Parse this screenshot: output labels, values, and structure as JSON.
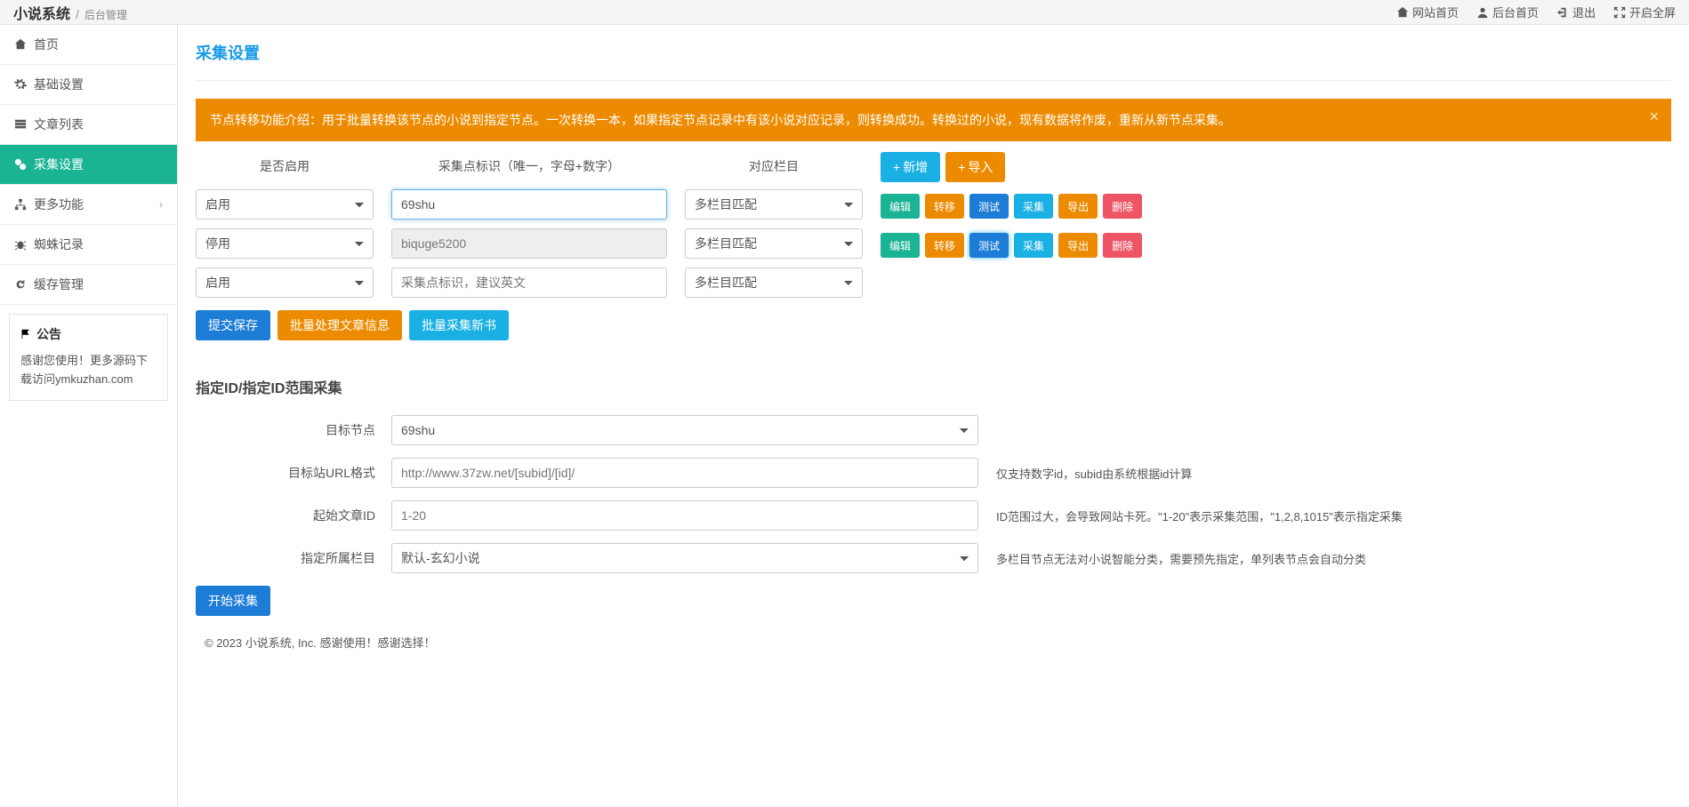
{
  "topbar": {
    "brand": "小说系统",
    "brand_sub": "后台管理",
    "links": {
      "site_home": "网站首页",
      "admin_home": "后台首页",
      "logout": "退出",
      "fullscreen": "开启全屏"
    }
  },
  "sidebar": {
    "items": [
      {
        "label": "首页"
      },
      {
        "label": "基础设置"
      },
      {
        "label": "文章列表"
      },
      {
        "label": "采集设置"
      },
      {
        "label": "更多功能"
      },
      {
        "label": "蜘蛛记录"
      },
      {
        "label": "缓存管理"
      }
    ],
    "notice_title": "公告",
    "notice_text": "感谢您使用！更多源码下载访问ymkuzhan.com"
  },
  "page": {
    "title": "采集设置",
    "alert": "节点转移功能介绍：用于批量转换该节点的小说到指定节点。一次转换一本，如果指定节点记录中有该小说对应记录，则转换成功。转换过的小说，现有数据将作废，重新从新节点采集。"
  },
  "grid": {
    "headers": {
      "enable": "是否启用",
      "ident": "采集点标识（唯一，字母+数字）",
      "category": "对应栏目"
    },
    "top_buttons": {
      "add": "新增",
      "import": "导入"
    },
    "row_actions": {
      "edit": "编辑",
      "transfer": "转移",
      "test": "测试",
      "collect": "采集",
      "export": "导出",
      "delete": "删除"
    },
    "rows": [
      {
        "enable": "启用",
        "ident": "69shu",
        "category": "多栏目匹配"
      },
      {
        "enable": "停用",
        "ident": "biquge5200",
        "category": "多栏目匹配"
      },
      {
        "enable": "启用",
        "ident_placeholder": "采集点标识，建议英文",
        "category": "多栏目匹配"
      }
    ],
    "submit": {
      "save": "提交保存",
      "batch_info": "批量处理文章信息",
      "batch_collect": "批量采集新书"
    }
  },
  "id_section": {
    "title": "指定ID/指定ID范围采集",
    "target_label": "目标节点",
    "target_value": "69shu",
    "url_label": "目标站URL格式",
    "url_placeholder": "http://www.37zw.net/[subid]/[id]/",
    "url_help": "仅支持数字id，subid由系统根据id计算",
    "start_label": "起始文章ID",
    "start_placeholder": "1-20",
    "start_help": "ID范围过大，会导致网站卡死。\"1-20\"表示采集范围，\"1,2,8,1015\"表示指定采集",
    "cat_label": "指定所属栏目",
    "cat_value": "默认-玄幻小说",
    "cat_help": "多栏目节点无法对小说智能分类，需要预先指定，单列表节点会自动分类",
    "submit": "开始采集"
  },
  "footer": "© 2023 小说系统, Inc. 感谢使用！感谢选择！"
}
